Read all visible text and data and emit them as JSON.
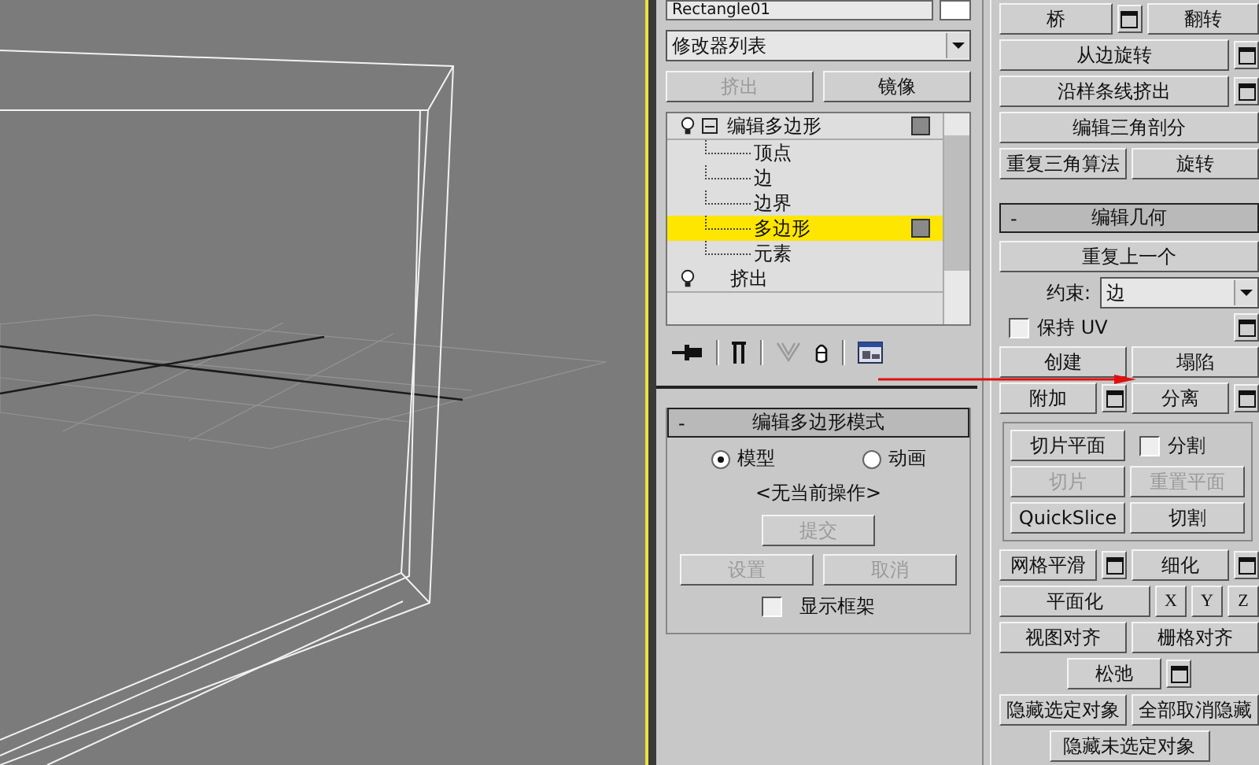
{
  "name_field": {
    "value": "Rectangle01"
  },
  "modifier_list": {
    "value": "修改器列表"
  },
  "stack_buttons": [
    {
      "label": "挤出",
      "disabled": true
    },
    {
      "label": "镜像",
      "disabled": false
    }
  ],
  "modifier_stack": [
    {
      "label": "编辑多边形",
      "expanded": true,
      "selected": false,
      "marker": true,
      "children": [
        {
          "label": "顶点",
          "selected": false,
          "marker": false
        },
        {
          "label": "边",
          "selected": false,
          "marker": false
        },
        {
          "label": "边界",
          "selected": false,
          "marker": false
        },
        {
          "label": "多边形",
          "selected": true,
          "marker": true
        },
        {
          "label": "元素",
          "selected": false,
          "marker": false
        }
      ]
    },
    {
      "label": "挤出",
      "selected": false,
      "marker": false
    }
  ],
  "edit_poly_mode": {
    "toggle": "-",
    "title": "编辑多边形模式",
    "radios": [
      {
        "label": "模型",
        "selected": true
      },
      {
        "label": "动画",
        "selected": false
      }
    ],
    "status": "<无当前操作>",
    "commit": {
      "label": "提交",
      "disabled": true
    },
    "buttons": [
      {
        "label": "设置",
        "disabled": true
      },
      {
        "label": "取消",
        "disabled": true
      }
    ],
    "checkbox": {
      "label": "显示框架",
      "checked": false
    }
  },
  "right_top_rows": [
    {
      "items": [
        {
          "kind": "button",
          "label": "桥",
          "disabled": false
        },
        {
          "kind": "settings_button"
        },
        {
          "kind": "button",
          "label": "翻转",
          "disabled": false
        }
      ]
    },
    {
      "items": [
        {
          "kind": "button",
          "label": "从边旋转",
          "disabled": false
        },
        {
          "kind": "settings_button"
        }
      ]
    },
    {
      "items": [
        {
          "kind": "button",
          "label": "沿样条线挤出",
          "disabled": false
        },
        {
          "kind": "settings_button"
        }
      ]
    },
    {
      "items": [
        {
          "kind": "button",
          "label": "编辑三角剖分",
          "disabled": false
        }
      ]
    },
    {
      "items": [
        {
          "kind": "button",
          "label": "重复三角算法",
          "disabled": false
        },
        {
          "kind": "button",
          "label": "旋转",
          "disabled": false
        }
      ]
    }
  ],
  "edit_geometry": {
    "toggle": "-",
    "title": "编辑几何",
    "rows": [
      {
        "items": [
          {
            "kind": "button",
            "label": "重复上一个",
            "disabled": false
          }
        ]
      },
      {
        "items": [
          {
            "kind": "label",
            "label": "约束:"
          },
          {
            "kind": "select",
            "value": "边"
          }
        ]
      },
      {
        "items": [
          {
            "kind": "checkbox",
            "label": "保持 UV",
            "checked": false
          },
          {
            "kind": "settings_button"
          }
        ]
      },
      {
        "items": [
          {
            "kind": "button",
            "label": "创建",
            "disabled": false
          },
          {
            "kind": "button",
            "label": "塌陷",
            "disabled": false
          }
        ]
      },
      {
        "items": [
          {
            "kind": "button",
            "label": "附加",
            "disabled": false
          },
          {
            "kind": "settings_button"
          },
          {
            "kind": "button",
            "label": "分离",
            "disabled": false
          },
          {
            "kind": "settings_button"
          }
        ]
      }
    ],
    "slice_group": [
      {
        "items": [
          {
            "kind": "button",
            "label": "切片平面",
            "disabled": false
          },
          {
            "kind": "checkbox",
            "label": "分割",
            "checked": false
          }
        ]
      },
      {
        "items": [
          {
            "kind": "button",
            "label": "切片",
            "disabled": true
          },
          {
            "kind": "button",
            "label": "重置平面",
            "disabled": true
          }
        ]
      },
      {
        "items": [
          {
            "kind": "button",
            "label": "QuickSlice",
            "disabled": false
          },
          {
            "kind": "button",
            "label": "切割",
            "disabled": false
          }
        ]
      }
    ],
    "rows_after": [
      {
        "items": [
          {
            "kind": "button",
            "label": "网格平滑",
            "disabled": false
          },
          {
            "kind": "settings_button"
          },
          {
            "kind": "button",
            "label": "细化",
            "disabled": false
          },
          {
            "kind": "settings_button"
          }
        ]
      },
      {
        "items": [
          {
            "kind": "button",
            "label": "平面化",
            "disabled": false
          },
          {
            "kind": "axis_button",
            "label": "X",
            "disabled": false
          },
          {
            "kind": "axis_button",
            "label": "Y",
            "disabled": false
          },
          {
            "kind": "axis_button",
            "label": "Z",
            "disabled": false
          }
        ]
      },
      {
        "items": [
          {
            "kind": "button",
            "label": "视图对齐",
            "disabled": false
          },
          {
            "kind": "button",
            "label": "栅格对齐",
            "disabled": false
          }
        ]
      },
      {
        "items": [
          {
            "kind": "short_button",
            "label": "松弛",
            "disabled": false
          },
          {
            "kind": "settings_button"
          }
        ]
      },
      {
        "items": [
          {
            "kind": "button",
            "label": "隐藏选定对象",
            "disabled": false
          },
          {
            "kind": "button",
            "label": "全部取消隐藏",
            "disabled": false
          }
        ]
      },
      {
        "items": [
          {
            "kind": "short_button",
            "label": "隐藏未选定对象",
            "disabled": false
          }
        ]
      }
    ]
  }
}
